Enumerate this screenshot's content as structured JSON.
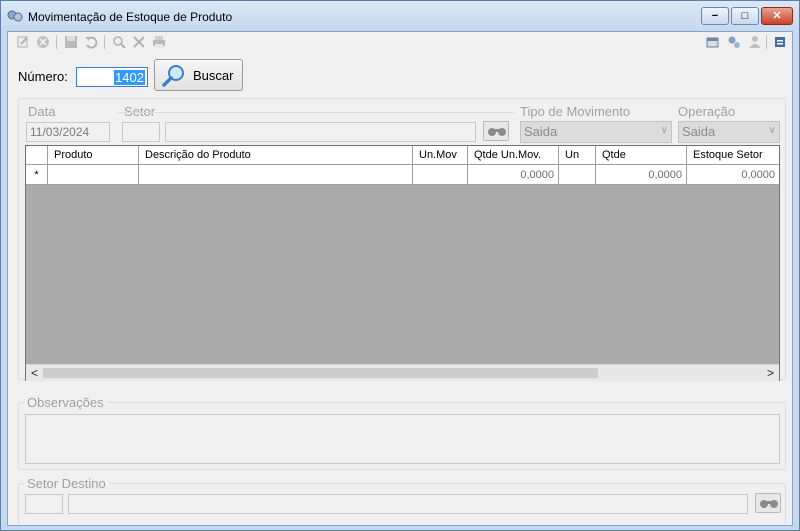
{
  "window": {
    "title": "Movimentação de Estoque de Produto",
    "controls": {
      "minimize": "−",
      "maximize": "□",
      "close": "✕"
    }
  },
  "toolbar": {
    "left_icons": [
      "edit-icon",
      "cancel-icon",
      "save-icon",
      "undo-icon",
      "zoom-icon",
      "tools-icon",
      "print-icon"
    ],
    "right_icons": [
      "window-icon",
      "settings-icon",
      "user-icon",
      "menu-icon"
    ]
  },
  "search": {
    "numero_label": "Número:",
    "numero_value": "1402",
    "buscar_label": "Buscar"
  },
  "header": {
    "data_label": "Data",
    "data_value": "11/03/2024",
    "setor_label": "Setor",
    "tipo_label": "Tipo de Movimento",
    "tipo_value": "Saida",
    "operacao_label": "Operação",
    "operacao_value": "Saida"
  },
  "grid": {
    "columns": [
      "Produto",
      "Descrição do Produto",
      "Un.Mov",
      "Qtde Un.Mov.",
      "Un",
      "Qtde",
      "Estoque Setor"
    ],
    "new_row_marker": "*",
    "new_row": {
      "qtde_un_mov": "0,0000",
      "qtde": "0,0000",
      "estoque_setor": "0,0000"
    },
    "scroll_left": "<",
    "scroll_right": ">"
  },
  "observacoes": {
    "label": "Observações"
  },
  "setor_destino": {
    "label": "Setor Destino"
  }
}
